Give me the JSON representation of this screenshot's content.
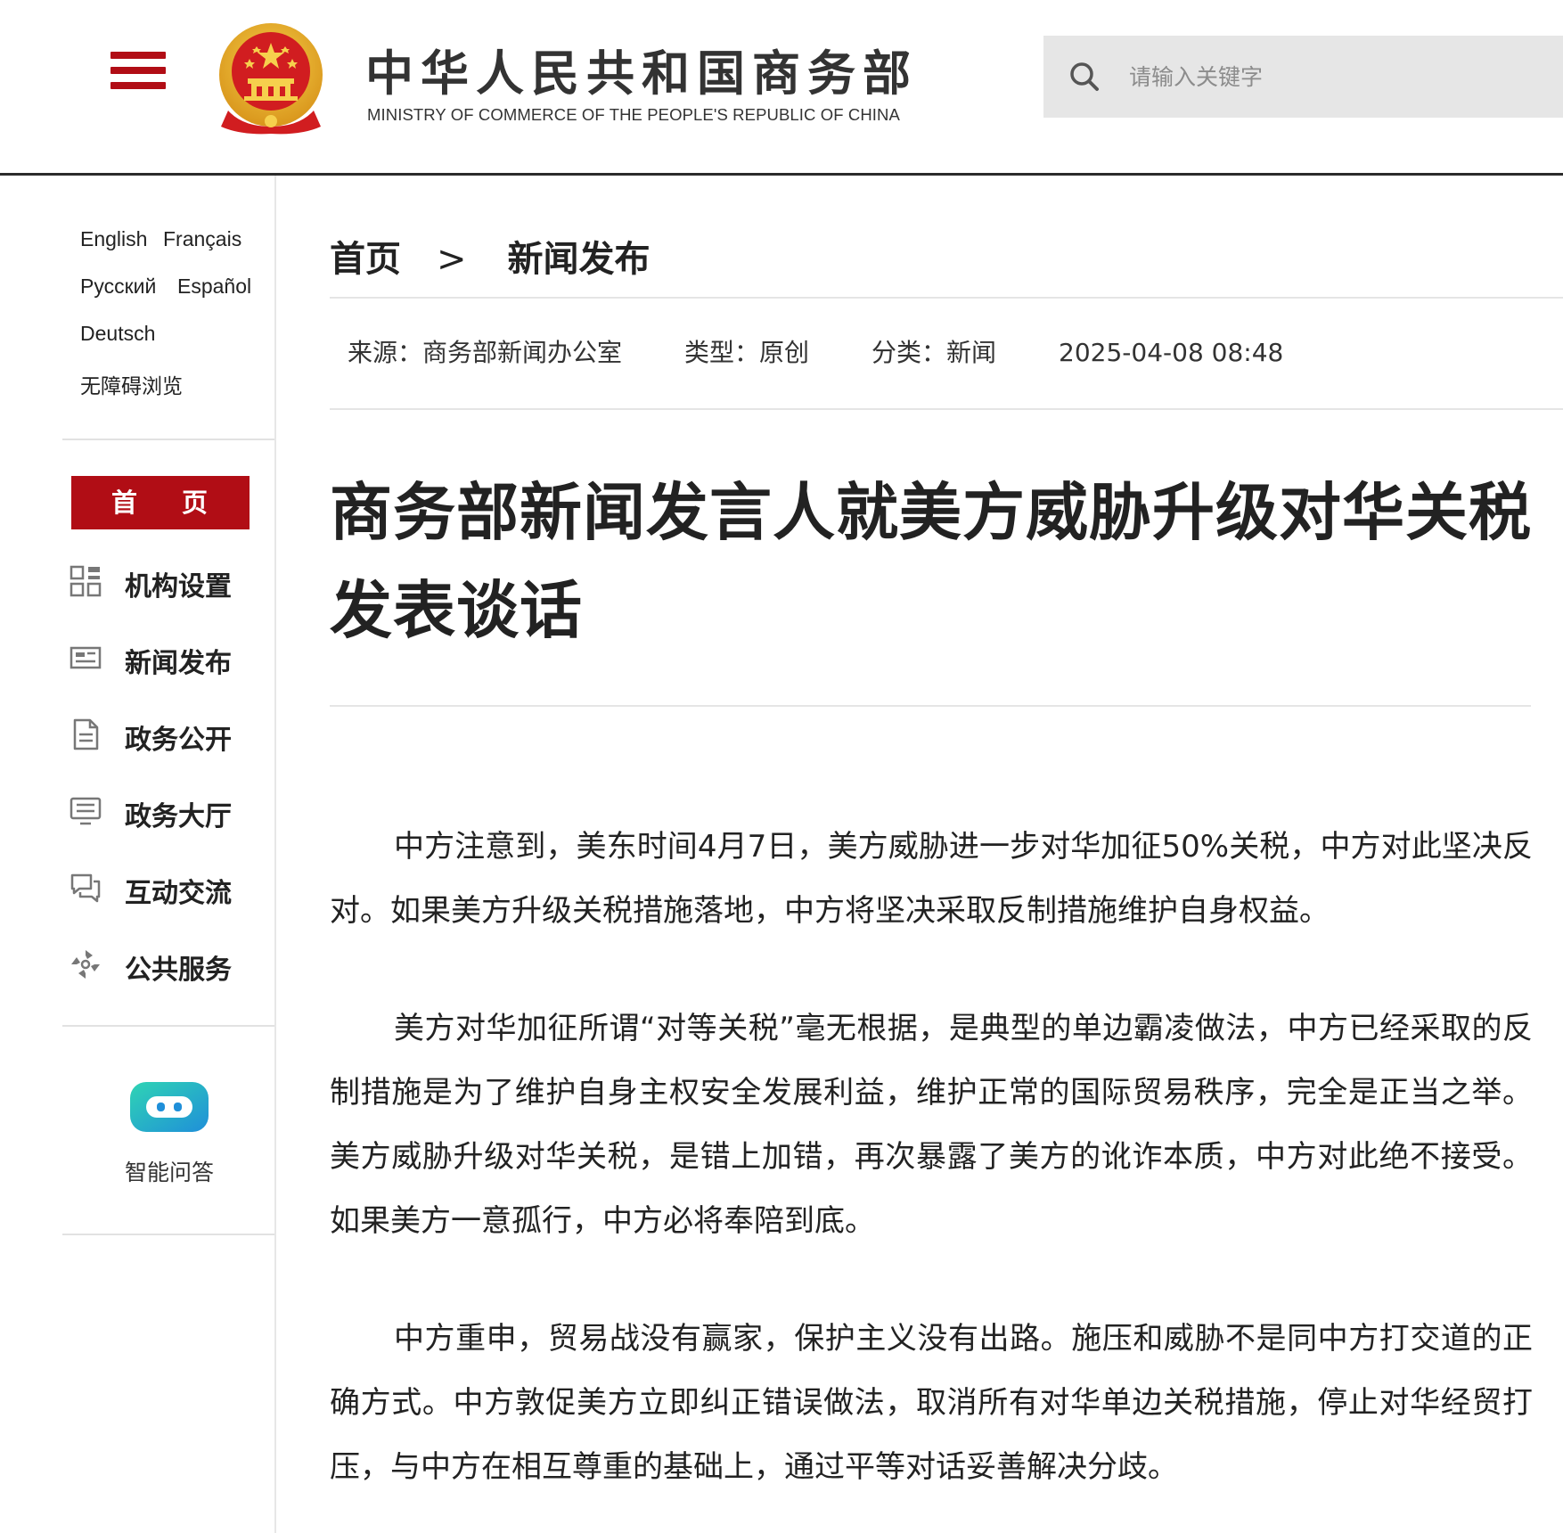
{
  "header": {
    "site_title": "中华人民共和国商务部",
    "site_subtitle": "MINISTRY OF COMMERCE OF THE PEOPLE'S REPUBLIC OF CHINA",
    "search_placeholder": "请输入关键字"
  },
  "sidebar": {
    "languages": [
      "English",
      "Français",
      "Русский",
      "Español",
      "Deutsch"
    ],
    "accessibility": "无障碍浏览",
    "home": "首 页",
    "nav": [
      {
        "label": "机构设置",
        "icon": "grid-icon"
      },
      {
        "label": "新闻发布",
        "icon": "newspaper-icon"
      },
      {
        "label": "政务公开",
        "icon": "document-icon"
      },
      {
        "label": "政务大厅",
        "icon": "monitor-icon"
      },
      {
        "label": "互动交流",
        "icon": "chat-icon"
      },
      {
        "label": "公共服务",
        "icon": "service-icon"
      }
    ],
    "assistant": "智能问答"
  },
  "breadcrumb": {
    "home": "首页",
    "separator": ">",
    "current": "新闻发布"
  },
  "meta": {
    "source": "来源：商务部新闻办公室",
    "type": "类型：原创",
    "category": "分类：新闻",
    "datetime": "2025-04-08 08:48"
  },
  "article": {
    "title": "商务部新闻发言人就美方威胁升级对华关税发表谈话",
    "paragraphs": [
      "中方注意到，美东时间4月7日，美方威胁进一步对华加征50%关税，中方对此坚决反对。如果美方升级关税措施落地，中方将坚决采取反制措施维护自身权益。",
      "美方对华加征所谓“对等关税”毫无根据，是典型的单边霸凌做法，中方已经采取的反制措施是为了维护自身主权安全发展利益，维护正常的国际贸易秩序，完全是正当之举。美方威胁升级对华关税，是错上加错，再次暴露了美方的讹诈本质，中方对此绝不接受。如果美方一意孤行，中方必将奉陪到底。",
      "中方重申，贸易战没有赢家，保护主义没有出路。施压和威胁不是同中方打交道的正确方式。中方敦促美方立即纠正错误做法，取消所有对华单边关税措施，停止对华经贸打压，与中方在相互尊重的基础上，通过平等对话妥善解决分歧。"
    ]
  },
  "colors": {
    "accent_red": "#b10d15",
    "search_bg": "#e6e6e6",
    "bot_gradient_start": "#2fd4b4",
    "bot_gradient_end": "#1f8fd9"
  }
}
